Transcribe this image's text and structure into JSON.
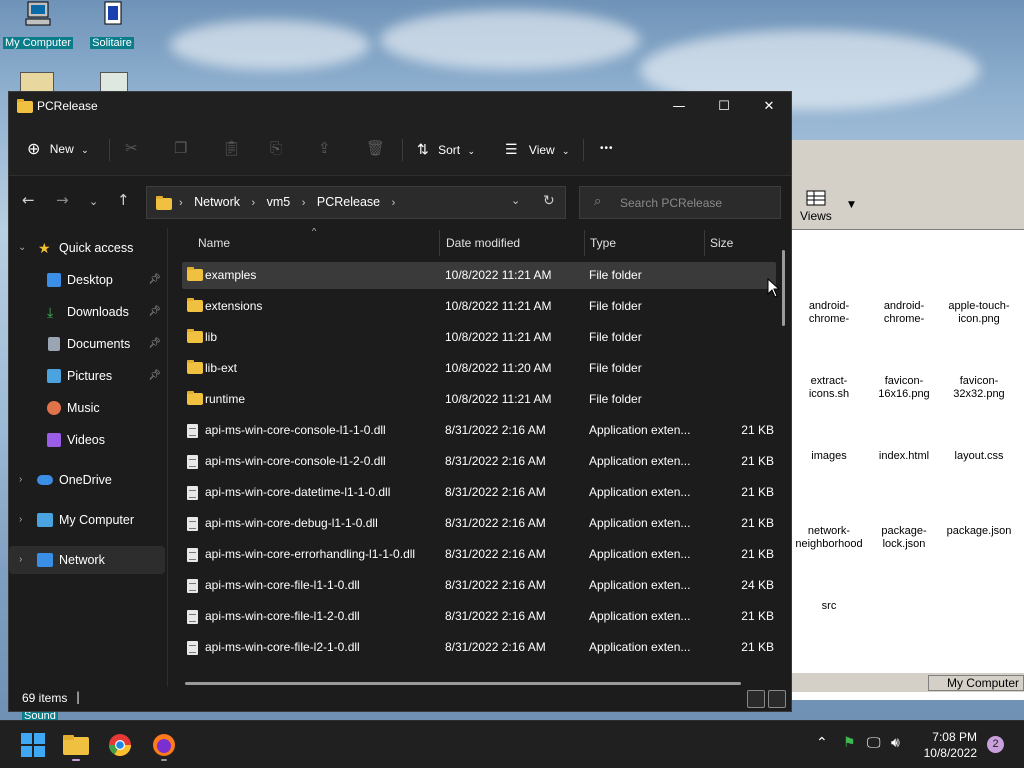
{
  "desktop": {
    "icons": [
      {
        "label": "My Computer"
      },
      {
        "label": "Solitaire"
      }
    ],
    "partial_label": "Sound"
  },
  "background_window": {
    "views_label": "Views",
    "files": [
      "android-chrome-",
      "android-chrome-",
      "apple-touch-icon.png",
      "extract-icons.sh",
      "favicon-16x16.png",
      "favicon-32x32.png",
      "images",
      "index.html",
      "layout.css",
      "network-neighborhood",
      "package-lock.json",
      "package.json",
      "src"
    ],
    "status_label": "My Computer"
  },
  "explorer": {
    "title": "PCRelease",
    "toolbar": {
      "new_label": "New",
      "sort_label": "Sort",
      "view_label": "View",
      "more_label": "•••"
    },
    "breadcrumb": [
      "Network",
      "vm5",
      "PCRelease"
    ],
    "search_placeholder": "Search PCRelease",
    "nav": {
      "quick_access": "Quick access",
      "items": [
        {
          "label": "Desktop",
          "color": "#3a8ee6"
        },
        {
          "label": "Downloads",
          "color": "#3fb950"
        },
        {
          "label": "Documents",
          "color": "#9aa4b2"
        },
        {
          "label": "Pictures",
          "color": "#4aa3df"
        },
        {
          "label": "Music",
          "color": "#e0734a"
        },
        {
          "label": "Videos",
          "color": "#9b5de5"
        }
      ],
      "onedrive": "OneDrive",
      "my_computer": "My Computer",
      "network": "Network"
    },
    "columns": {
      "name": "Name",
      "date": "Date modified",
      "type": "Type",
      "size": "Size"
    },
    "rows": [
      {
        "name": "examples",
        "date": "10/8/2022 11:21 AM",
        "type": "File folder",
        "size": "",
        "kind": "folder"
      },
      {
        "name": "extensions",
        "date": "10/8/2022 11:21 AM",
        "type": "File folder",
        "size": "",
        "kind": "folder"
      },
      {
        "name": "lib",
        "date": "10/8/2022 11:21 AM",
        "type": "File folder",
        "size": "",
        "kind": "folder"
      },
      {
        "name": "lib-ext",
        "date": "10/8/2022 11:20 AM",
        "type": "File folder",
        "size": "",
        "kind": "folder"
      },
      {
        "name": "runtime",
        "date": "10/8/2022 11:21 AM",
        "type": "File folder",
        "size": "",
        "kind": "folder"
      },
      {
        "name": "api-ms-win-core-console-l1-1-0.dll",
        "date": "8/31/2022 2:16 AM",
        "type": "Application exten...",
        "size": "21 KB",
        "kind": "file"
      },
      {
        "name": "api-ms-win-core-console-l1-2-0.dll",
        "date": "8/31/2022 2:16 AM",
        "type": "Application exten...",
        "size": "21 KB",
        "kind": "file"
      },
      {
        "name": "api-ms-win-core-datetime-l1-1-0.dll",
        "date": "8/31/2022 2:16 AM",
        "type": "Application exten...",
        "size": "21 KB",
        "kind": "file"
      },
      {
        "name": "api-ms-win-core-debug-l1-1-0.dll",
        "date": "8/31/2022 2:16 AM",
        "type": "Application exten...",
        "size": "21 KB",
        "kind": "file"
      },
      {
        "name": "api-ms-win-core-errorhandling-l1-1-0.dll",
        "date": "8/31/2022 2:16 AM",
        "type": "Application exten...",
        "size": "21 KB",
        "kind": "file"
      },
      {
        "name": "api-ms-win-core-file-l1-1-0.dll",
        "date": "8/31/2022 2:16 AM",
        "type": "Application exten...",
        "size": "24 KB",
        "kind": "file"
      },
      {
        "name": "api-ms-win-core-file-l1-2-0.dll",
        "date": "8/31/2022 2:16 AM",
        "type": "Application exten...",
        "size": "21 KB",
        "kind": "file"
      },
      {
        "name": "api-ms-win-core-file-l2-1-0.dll",
        "date": "8/31/2022 2:16 AM",
        "type": "Application exten...",
        "size": "21 KB",
        "kind": "file"
      }
    ],
    "status": {
      "item_count": "69 items"
    }
  },
  "taskbar": {
    "time": "7:08 PM",
    "date": "10/8/2022",
    "notification_count": "2"
  }
}
